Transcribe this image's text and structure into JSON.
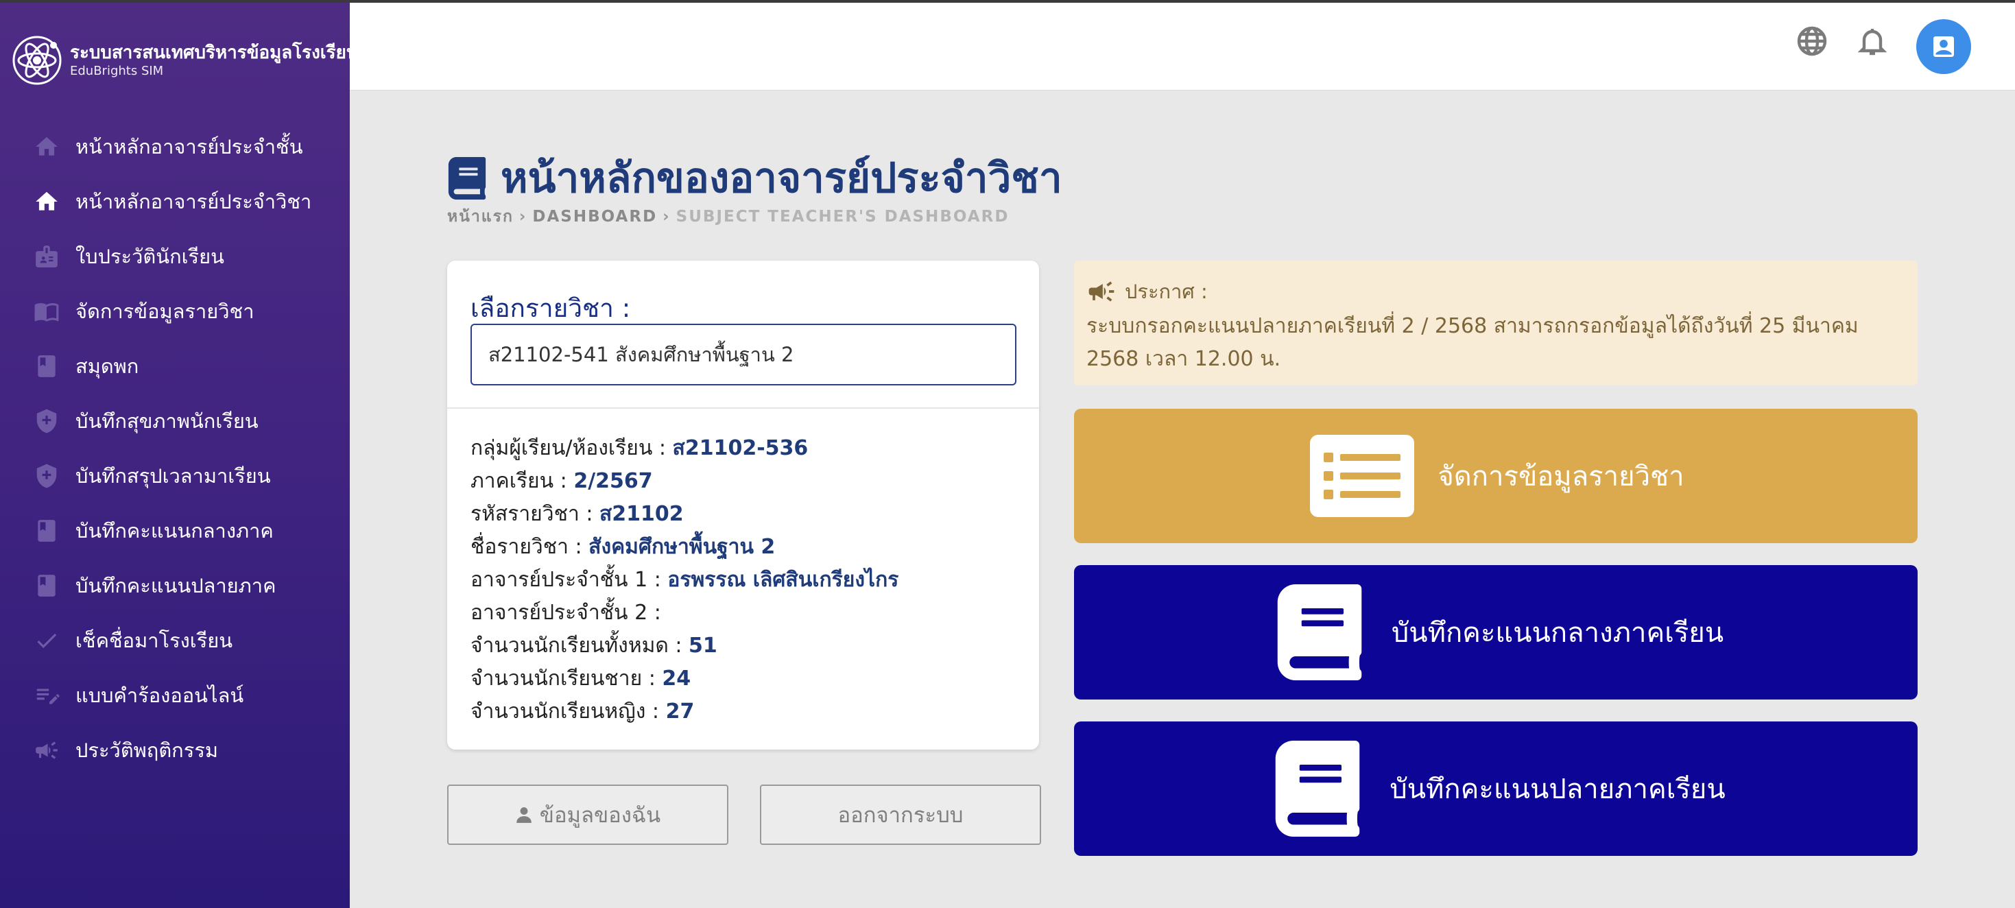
{
  "app": {
    "brand_title": "ระบบสารสนเทศบริหารข้อมูลโรงเรียน",
    "brand_subtitle": "EduBrights SIM"
  },
  "sidebar": {
    "items": [
      {
        "label": "หน้าหลักอาจารย์ประจำชั้น",
        "icon": "home-icon"
      },
      {
        "label": "หน้าหลักอาจารย์ประจำวิชา",
        "icon": "home-icon",
        "active": true
      },
      {
        "label": "ใบประวัตินักเรียน",
        "icon": "id-badge-icon"
      },
      {
        "label": "จัดการข้อมูลรายวิชา",
        "icon": "open-book-icon"
      },
      {
        "label": "สมุดพก",
        "icon": "book-icon"
      },
      {
        "label": "บันทึกสุขภาพนักเรียน",
        "icon": "shield-plus-icon"
      },
      {
        "label": "บันทึกสรุปเวลามาเรียน",
        "icon": "shield-plus-icon"
      },
      {
        "label": "บันทึกคะแนนกลางภาค",
        "icon": "book-icon"
      },
      {
        "label": "บันทึกคะแนนปลายภาค",
        "icon": "book-icon"
      },
      {
        "label": "เช็คชื่อมาโรงเรียน",
        "icon": "check-icon"
      },
      {
        "label": "แบบคำร้องออนไลน์",
        "icon": "edit-list-icon"
      },
      {
        "label": "ประวัติพฤติกรรม",
        "icon": "megaphone-icon"
      }
    ]
  },
  "topbar": {
    "icons": [
      "globe-icon",
      "bell-icon",
      "user-avatar-icon"
    ]
  },
  "header": {
    "title": "หน้าหลักของอาจารย์ประจำวิชา",
    "breadcrumb": [
      "หน้าแรก",
      "DASHBOARD",
      "SUBJECT TEACHER'S DASHBOARD"
    ]
  },
  "subject_card": {
    "select_label": "เลือกรายวิชา :",
    "selected_subject": "ส21102-541 สังคมศึกษาพื้นฐาน 2",
    "rows": [
      {
        "label": "กลุ่มผู้เรียน/ห้องเรียน : ",
        "value": "ส21102-536"
      },
      {
        "label": "ภาคเรียน : ",
        "value": "2/2567"
      },
      {
        "label": "รหัสรายวิชา : ",
        "value": "ส21102"
      },
      {
        "label": "ชื่อรายวิชา : ",
        "value": "สังคมศึกษาพื้นฐาน 2"
      },
      {
        "label": "อาจารย์ประจำชั้น 1 : ",
        "value": "อรพรรณ เลิศสินเกรียงไกร"
      },
      {
        "label": "อาจารย์ประจำชั้น 2 : ",
        "value": ""
      },
      {
        "label": "จำนวนนักเรียนทั้งหมด : ",
        "value": "51"
      },
      {
        "label": "จำนวนนักเรียนชาย : ",
        "value": "24"
      },
      {
        "label": "จำนวนนักเรียนหญิง : ",
        "value": "27"
      }
    ]
  },
  "buttons": {
    "my_info": "ข้อมูลของฉัน",
    "logout": "ออกจากระบบ"
  },
  "announcement": {
    "heading": "ประกาศ :",
    "text": "ระบบกรอกคะแนนปลายภาคเรียนที่ 2 / 2568 สามารถกรอกข้อมูลได้ถึงวันที่ 25 มีนาคม 2568 เวลา 12.00 น."
  },
  "tiles": [
    {
      "label": "จัดการข้อมูลรายวิชา",
      "icon": "list-icon",
      "color": "#dcaa4e"
    },
    {
      "label": "บันทึกคะแนนกลางภาคเรียน",
      "icon": "book-icon",
      "color": "#0c0596"
    },
    {
      "label": "บันทึกคะแนนปลายภาคเรียน",
      "icon": "book-icon",
      "color": "#0c0596"
    }
  ],
  "colors": {
    "sidebar_top": "#4e2c84",
    "sidebar_bottom": "#2c1a78",
    "title_blue": "#1f3b79",
    "avatar_blue": "#3c8ee8",
    "announcement_bg": "#f8ecd6"
  }
}
